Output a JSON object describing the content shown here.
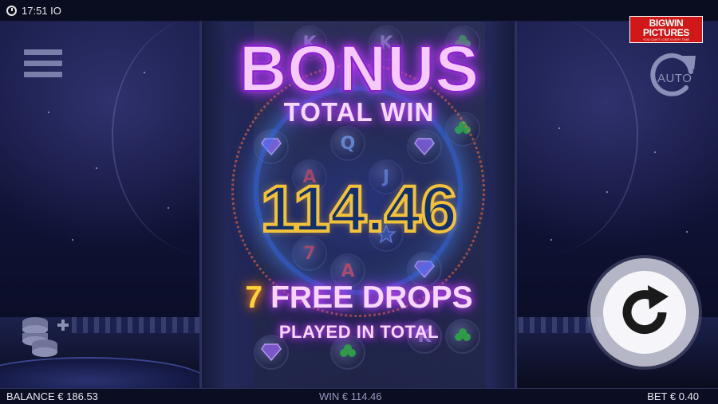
{
  "status_bar": {
    "time": "17:51 IO"
  },
  "logo": {
    "main": "BIGWIN\nPICTURES",
    "tagline": "YOU CAN'T LOSE EVERY TIME"
  },
  "bonus": {
    "title": "BONUS",
    "subtitle": "TOTAL WIN",
    "amount": "114.46",
    "drops_count": "7",
    "drops_label": "FREE DROPS",
    "played_label": "PLAYED IN TOTAL"
  },
  "controls": {
    "auto_label": "AUTO"
  },
  "reel_symbols": [
    "K",
    "K",
    "Q",
    "J",
    "A",
    "7",
    "A",
    "K"
  ],
  "bottom_bar": {
    "balance": "BALANCE € 186.53",
    "win": "WIN € 114.46",
    "bet": "BET € 0.40"
  },
  "colors": {
    "title_glow": "#c64bff",
    "amount_outline": "#f2c13c",
    "drops_number": "#ffd23a",
    "logo_bg": "#d01818"
  }
}
